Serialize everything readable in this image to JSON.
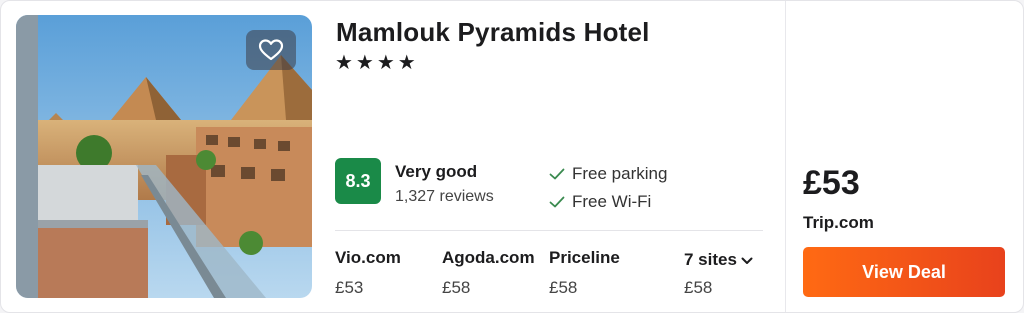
{
  "colors": {
    "score_badge": "#1a8a48",
    "deal_button_start": "#ff6a13",
    "deal_button_end": "#e8421c",
    "check": "#3a8a4f"
  },
  "hotel": {
    "name": "Mamlouk Pyramids Hotel",
    "stars_display": "★★★★",
    "star_count": 4,
    "favorite_icon": "heart-outline-icon"
  },
  "rating": {
    "score": "8.3",
    "label": "Very good",
    "reviews": "1,327 reviews"
  },
  "amenities": [
    {
      "label": "Free parking",
      "icon": "checkmark-icon"
    },
    {
      "label": "Free Wi-Fi",
      "icon": "checkmark-icon"
    }
  ],
  "prices": [
    {
      "site": "Vio.com",
      "price": "£53"
    },
    {
      "site": "Agoda.com",
      "price": "£58"
    },
    {
      "site": "Priceline",
      "price": "£58"
    }
  ],
  "more_sites": {
    "label": "7 sites",
    "price": "£58",
    "icon": "chevron-down-icon"
  },
  "deal": {
    "price": "£53",
    "site": "Trip.com",
    "button_label": "View Deal"
  }
}
